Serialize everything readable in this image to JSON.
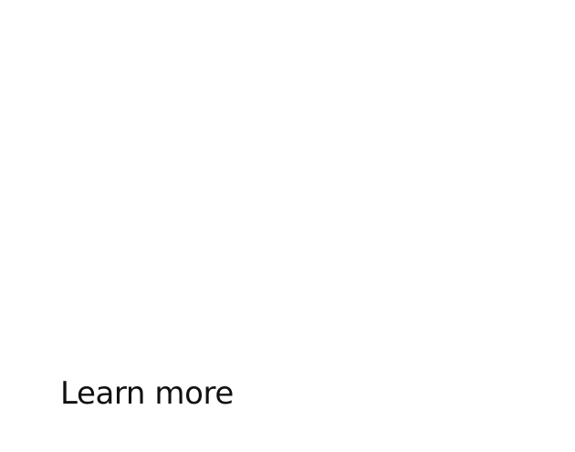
{
  "cta": {
    "label": "Learn more"
  },
  "colors": {
    "background": "#ffffff",
    "text": "#111111"
  }
}
